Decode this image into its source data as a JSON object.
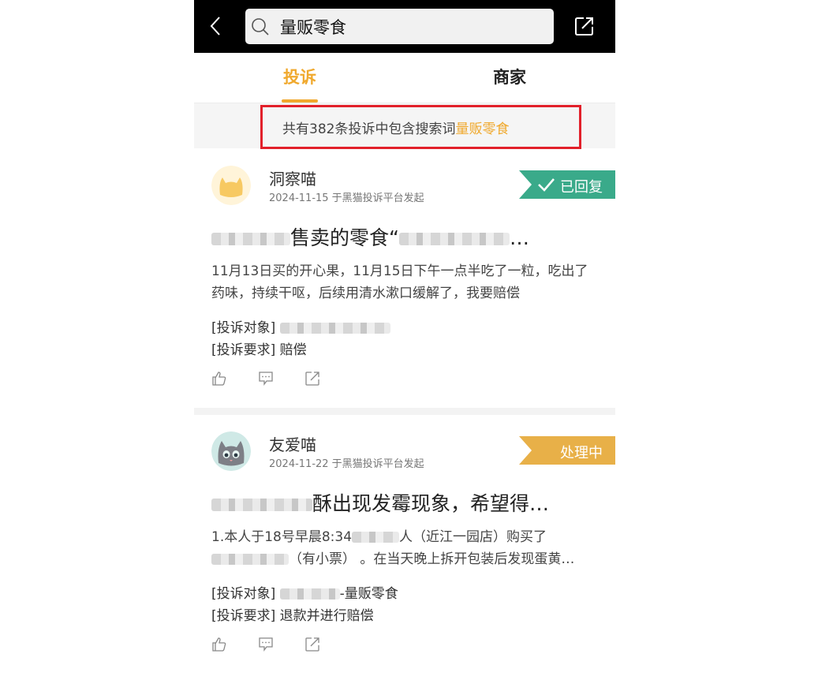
{
  "search": {
    "value": "量贩零食"
  },
  "tabs": [
    {
      "label": "投诉",
      "active": true
    },
    {
      "label": "商家",
      "active": false
    }
  ],
  "banner": {
    "prefix": "共有382条投诉中包含搜索词",
    "keyword": "量贩零食",
    "count": 382
  },
  "colors": {
    "accent": "#f0a92e",
    "highlight_box": "#e2202a",
    "replied": "#3aaa8a",
    "processing": "#e8b048"
  },
  "complaints": [
    {
      "user": "洞察喵",
      "date": "2024-11-15 于黑猫投诉平台发起",
      "status": "已回复",
      "status_icon": "checkmark-icon",
      "avatar": "yellow-cat-avatar",
      "title_visible": "售卖的零食“",
      "title_tail": "…",
      "body": "11月13日买的开心果，11月15日下午一点半吃了一粒，吃出了药味，持续干呕，后续用清水漱口缓解了，我要赔偿",
      "target_label": "[投诉对象]",
      "target_value": "",
      "demand_label": "[投诉要求]",
      "demand_value": "赔偿"
    },
    {
      "user": "友爱喵",
      "date": "2024-11-22 于黑猫投诉平台发起",
      "status": "处理中",
      "avatar": "gray-cat-avatar",
      "title_visible": "酥出现发霉现象，希望得…",
      "body_line1a": "1.本人于18号早晨8:34",
      "body_line1b": "人（近江一园店）购买了",
      "body_line2": "（有小票） 。在当天晚上拆开包装后发现蛋黄…",
      "target_label": "[投诉对象]",
      "target_value": "-量贩零食",
      "demand_label": "[投诉要求]",
      "demand_value": "退款并进行赔偿"
    }
  ]
}
